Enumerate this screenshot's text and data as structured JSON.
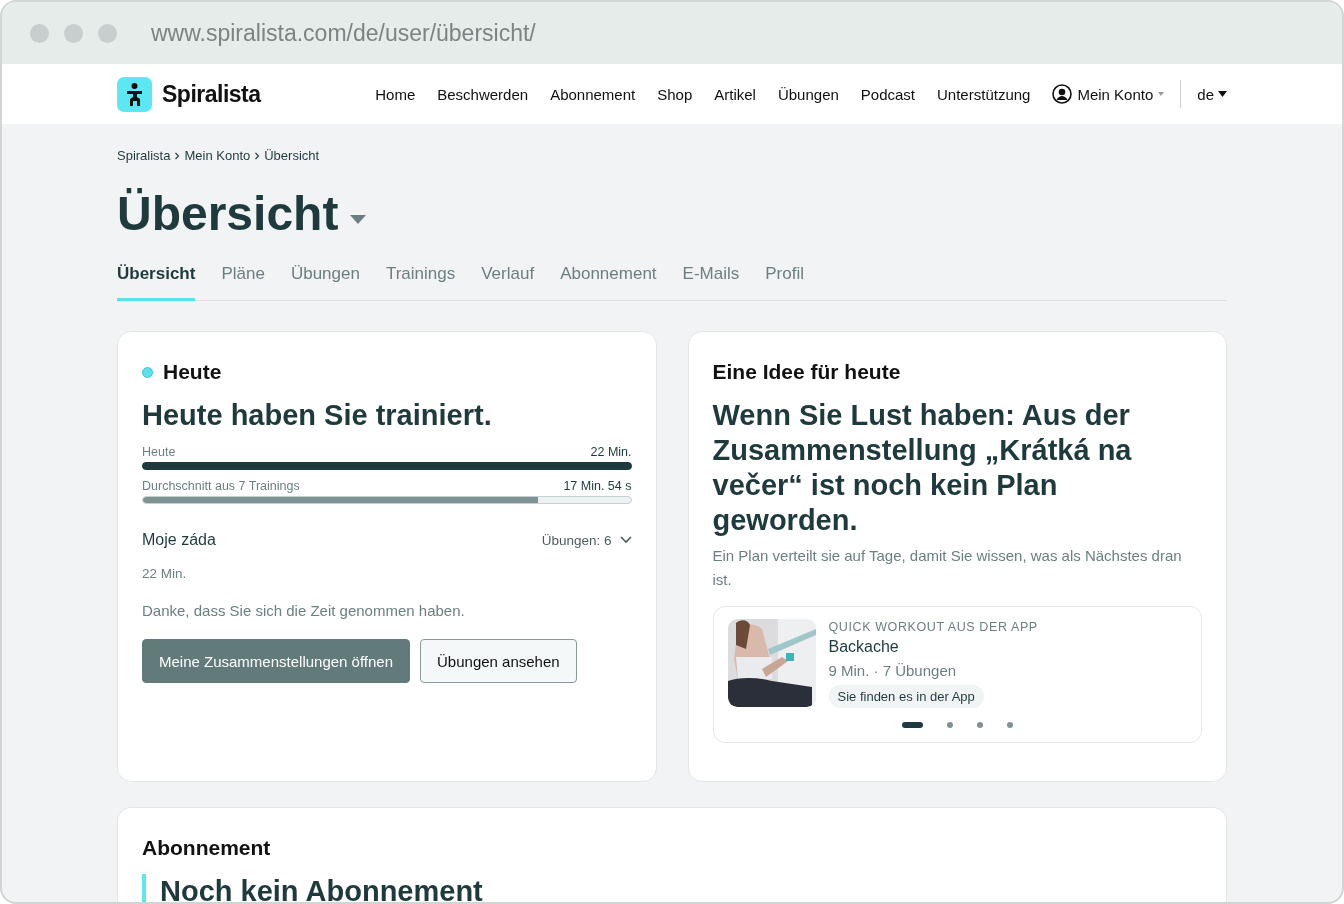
{
  "browser": {
    "url": "www.spiralista.com/de/user/übersicht/"
  },
  "site_nav": {
    "logo": "Spiralista",
    "items": [
      {
        "label": "Home"
      },
      {
        "label": "Beschwerden"
      },
      {
        "label": "Abonnement"
      },
      {
        "label": "Shop"
      },
      {
        "label": "Artikel"
      },
      {
        "label": "Übungen"
      },
      {
        "label": "Podcast"
      },
      {
        "label": "Unterstützung"
      }
    ],
    "account": "Mein Konto",
    "language": "de"
  },
  "breadcrumb": [
    "Spiralista",
    "Mein Konto",
    "Übersicht"
  ],
  "page_title": "Übersicht",
  "tabs": [
    {
      "label": "Übersicht",
      "selected": true
    },
    {
      "label": "Pläne",
      "selected": false
    },
    {
      "label": "Übungen",
      "selected": false
    },
    {
      "label": "Trainings",
      "selected": false
    },
    {
      "label": "Verlauf",
      "selected": false
    },
    {
      "label": "Abonnement",
      "selected": false
    },
    {
      "label": "E-Mails",
      "selected": false
    },
    {
      "label": "Profil",
      "selected": false
    }
  ],
  "today": {
    "title": "Heute",
    "headline": "Heute haben Sie trainiert.",
    "bars": [
      {
        "label": "Heute",
        "reading": "22 Min.",
        "level": 1.0,
        "kind": "dark"
      },
      {
        "label": "Durchschnitt aus 7 Trainings",
        "reading": "17 Min. 54 s",
        "level": 0.81,
        "kind": "light"
      }
    ],
    "session": {
      "name": "Moje záda",
      "exercises": "Übungen: 6",
      "expanded": false,
      "duration": "22 Min."
    },
    "message": "Danke, dass Sie sich die Zeit genommen haben.",
    "buttons": [
      {
        "label": "Meine Zusammenstellungen öffnen",
        "kind": "primary"
      },
      {
        "label": "Übungen ansehen",
        "kind": "secondary"
      }
    ]
  },
  "idea": {
    "title": "Eine Idee für heute",
    "headline": "Wenn Sie Lust haben: Aus der Zusammenstellung „Krátká na večer“ ist noch kein Plan geworden.",
    "text": "Ein Plan verteilt sie auf Tage, damit Sie wissen, was als Nächstes dran ist.",
    "workout": {
      "eyebrow": "QUICK WORKOUT AUS DER APP",
      "name": "Backache",
      "meta": "9 Min. · 7 Übungen",
      "tag": "Sie finden es in der App"
    },
    "dots": [
      {
        "selected": true
      },
      {
        "selected": false
      },
      {
        "selected": false
      },
      {
        "selected": false
      }
    ]
  },
  "subscription": {
    "title": "Abonnement",
    "headline": "Noch kein Abonnement"
  }
}
